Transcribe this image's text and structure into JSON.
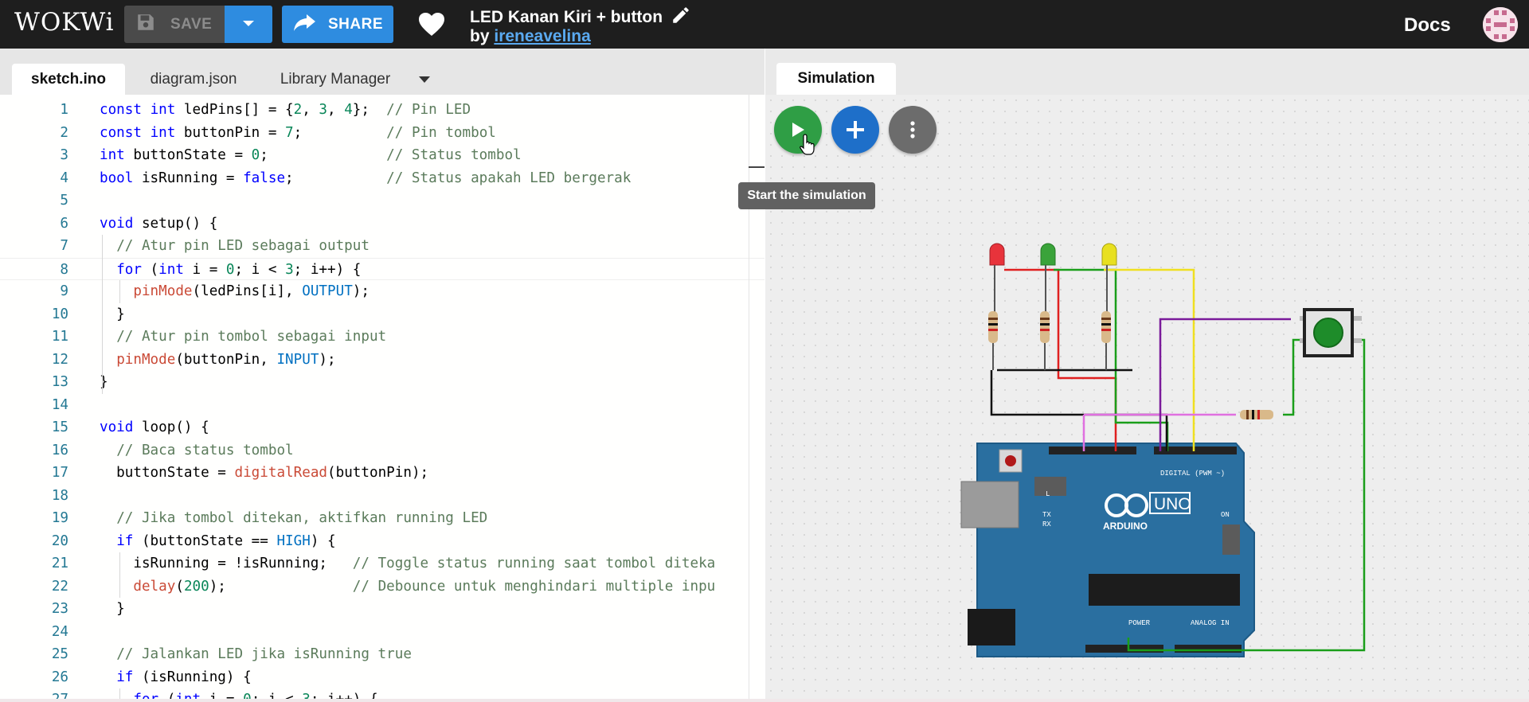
{
  "topbar": {
    "logo": "WOKWi",
    "save_label": "SAVE",
    "share_label": "SHARE",
    "project_title": "LED Kanan Kiri + button",
    "by_prefix": "by",
    "author": "ireneavelina",
    "docs_label": "Docs"
  },
  "editor": {
    "tabs": [
      "sketch.ino",
      "diagram.json",
      "Library Manager"
    ],
    "active_tab": "sketch.ino"
  },
  "code_lines": [
    "const int ledPins[] = {2, 3, 4};  // Pin LED",
    "const int buttonPin = 7;          // Pin tombol",
    "int buttonState = 0;              // Status tombol",
    "bool isRunning = false;           // Status apakah LED bergerak",
    "",
    "void setup() {",
    "  // Atur pin LED sebagai output",
    "  for (int i = 0; i < 3; i++) {",
    "    pinMode(ledPins[i], OUTPUT);",
    "  }",
    "  // Atur pin tombol sebagai input",
    "  pinMode(buttonPin, INPUT);",
    "}",
    "",
    "void loop() {",
    "  // Baca status tombol",
    "  buttonState = digitalRead(buttonPin);",
    "",
    "  // Jika tombol ditekan, aktifkan running LED",
    "  if (buttonState == HIGH) {",
    "    isRunning = !isRunning;   // Toggle status running saat tombol diteka",
    "    delay(200);               // Debounce untuk menghindari multiple inpu",
    "  }",
    "",
    "  // Jalankan LED jika isRunning true",
    "  if (isRunning) {",
    "    for (int i = 0; i < 3; i++) {"
  ],
  "simulation": {
    "tab_label": "Simulation",
    "tooltip": "Start the simulation",
    "board_labels": {
      "brand": "ARDUINO",
      "model": "UNO",
      "digital": "DIGITAL (PWM ~)",
      "analog": "ANALOG IN",
      "power": "POWER",
      "on": "ON",
      "tx": "TX",
      "rx": "RX",
      "l": "L"
    },
    "led_colors": [
      "#e8333b",
      "#3aa33a",
      "#e8e020"
    ]
  },
  "colors": {
    "topbar_bg": "#1e1e1e",
    "accent_blue": "#2e8ce0",
    "play_green": "#2f9e45",
    "add_blue": "#1e6fc9",
    "board_blue": "#2a6fa0"
  }
}
